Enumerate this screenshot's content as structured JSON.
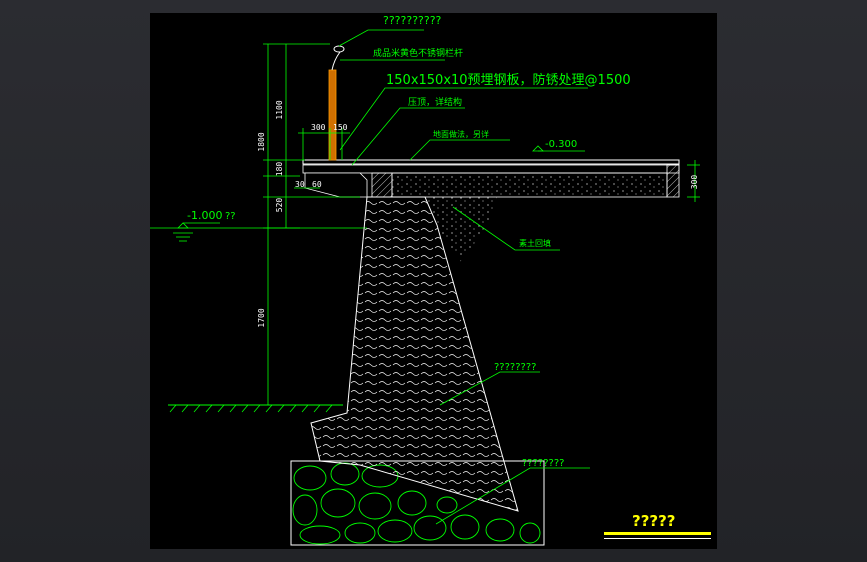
{
  "drawing": {
    "title_label": "?????",
    "labels": {
      "top": "??????????",
      "railing_note": "成品米黄色不锈钢栏杆",
      "plate_note": "150x150x10预埋钢板，防锈处理@1500",
      "joint_note": "压顶，详结构",
      "paving_note": "地面做法，另详",
      "level_top": "-0.300",
      "level_water": "-1.000",
      "level_water_suffix": "??",
      "backfill_note": "素土回填",
      "wall_note": "????????",
      "foundation_note": "????????"
    },
    "dimensions": {
      "d1100": "1100",
      "d1800": "1800",
      "d180": "180",
      "d520": "520",
      "d1700": "1700",
      "d300a": "300",
      "d150": "150",
      "d30": "30",
      "d60": "60",
      "d300b": "300"
    }
  },
  "colors": {
    "line_green": "#00ff00",
    "text_green": "#00ff00",
    "white": "#ffffff",
    "orange": "#ff8c00",
    "yellow": "#ffff00"
  }
}
